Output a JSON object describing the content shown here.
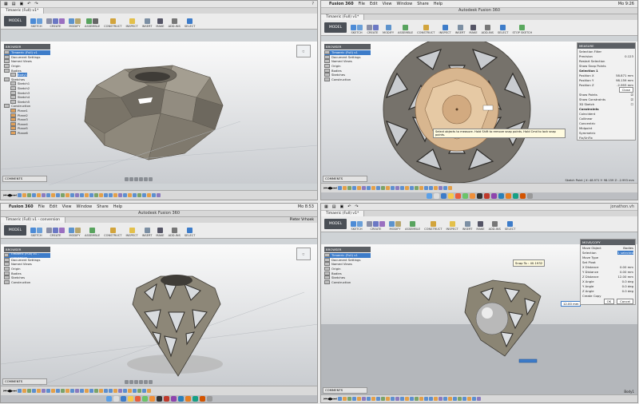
{
  "panel1": {
    "tab": "Timaeric (Full) v1*",
    "workspace": "MODEL",
    "groups": [
      "SKETCH",
      "CREATE",
      "MODIFY",
      "ASSEMBLE",
      "CONSTRUCT",
      "INSPECT",
      "INSERT",
      "MAKE",
      "ADD-INS",
      "SELECT"
    ],
    "browser_header": "BROWSER",
    "browser_items": [
      "Timaeric (Full) v1",
      "Document Settings",
      "Named Views",
      "Origin",
      "Bodies",
      "Body1",
      "Sketches",
      "Sketch1",
      "Sketch2",
      "Sketch3",
      "Sketch4",
      "Sketch5",
      "Construction",
      "Plane1",
      "Plane2",
      "Plane3",
      "Plane4",
      "Plane5",
      "Plane6"
    ],
    "comments": "COMMENTS"
  },
  "panel2": {
    "mac_app": "Fusion 360",
    "mac_menu": [
      "File",
      "Edit",
      "View",
      "Window",
      "Share",
      "Help"
    ],
    "window_title": "Autodesk Fusion 360",
    "clock": "Mo 9:26",
    "tab": "Timaeric (Full) v1*",
    "workspace": "MODEL",
    "groups": [
      "SKETCH",
      "CREATE",
      "MODIFY",
      "ASSEMBLE",
      "CONSTRUCT",
      "INSPECT",
      "INSERT",
      "MAKE",
      "ADD-INS",
      "SELECT",
      "STOP SKETCH"
    ],
    "browser_header": "BROWSER",
    "browser_items": [
      "Timaeric (Full) v1",
      "Document Settings",
      "Named Views",
      "Origin",
      "Bodies",
      "Sketches",
      "Construction"
    ],
    "measure_title": "MEASURE",
    "measure_rows": [
      [
        "Selection Filter",
        ""
      ],
      [
        "Precision",
        "0.123"
      ],
      [
        "Restart Selection",
        ""
      ],
      [
        "Show Snap Points",
        ""
      ],
      [
        "Selection 1",
        ""
      ],
      [
        "Position X",
        "58.871 mm"
      ],
      [
        "Position Y",
        "98.159 mm"
      ],
      [
        "Position Z",
        "-2.993 mm"
      ]
    ],
    "measure_close": "Close",
    "display_rows": [
      "Show Points",
      "Show Constraints",
      "3D Sketch"
    ],
    "constraints_header": "Constraints",
    "constraints": [
      "Coincident",
      "Collinear",
      "Concentric",
      "Midpoint",
      "Symmetric",
      "Fix/UnFix"
    ],
    "tooltip": "Select objects to measure. Hold Shift to remove snap points. Hold Cmd to lock snap points.",
    "status": "Sketch Point | X: 48.971 Y: 98.159 Z: -2.993 mm",
    "comments": "COMMENTS"
  },
  "panel3": {
    "mac_app": "Fusion 360",
    "mac_menu": [
      "File",
      "Edit",
      "View",
      "Window",
      "Share",
      "Help"
    ],
    "window_title": "Autodesk Fusion 360",
    "clock": "Mo 8:53",
    "user": "Pieter Vrhoek",
    "tab": "Timaeric (Full) v1 - conversion",
    "workspace": "MODEL",
    "groups": [
      "SKETCH",
      "CREATE",
      "MODIFY",
      "ASSEMBLE",
      "CONSTRUCT",
      "INSPECT",
      "INSERT",
      "MAKE",
      "ADD-INS",
      "SELECT"
    ],
    "browser_header": "BROWSER",
    "browser_items": [
      "Timaeric (Full) v1 - conversion",
      "Document Settings",
      "Named Views",
      "Origin",
      "Bodies",
      "Sketches",
      "Construction"
    ],
    "comments": "COMMENTS"
  },
  "panel4": {
    "tab": "Timaeric (Full) v1*",
    "user": "jonathon.vh",
    "workspace": "MODEL",
    "groups": [
      "SKETCH",
      "CREATE",
      "MODIFY",
      "ASSEMBLE",
      "CONSTRUCT",
      "INSPECT",
      "INSERT",
      "MAKE",
      "ADD-INS",
      "SELECT"
    ],
    "browser_header": "BROWSER",
    "browser_items": [
      "Timaeric (Full) v1",
      "Document Settings",
      "Named Views",
      "Origin",
      "Bodies",
      "Sketches",
      "Construction"
    ],
    "move_title": "MOVE/COPY",
    "move_rows": [
      [
        "Move Object",
        "Bodies"
      ],
      [
        "Selection",
        "1 selected"
      ],
      [
        "Move Type",
        ""
      ],
      [
        "Set Pivot",
        ""
      ],
      [
        "X Distance",
        "0.00 mm"
      ],
      [
        "Y Distance",
        "0.00 mm"
      ],
      [
        "Z Distance",
        "12.00 mm"
      ],
      [
        "X Angle",
        "0.0 deg"
      ],
      [
        "Y Angle",
        "0.0 deg"
      ],
      [
        "Z Angle",
        "0.0 deg"
      ],
      [
        "Create Copy",
        ""
      ]
    ],
    "ok": "OK",
    "cancel": "Cancel",
    "snap_tip": "Snap To : 40.1932",
    "dim_value": "12.00 mm",
    "status": "Body1",
    "comments": "COMMENTS"
  },
  "colors": {
    "accent": "#3d7cc9",
    "model": "#8b8577",
    "highlight": "#d8b68f"
  }
}
